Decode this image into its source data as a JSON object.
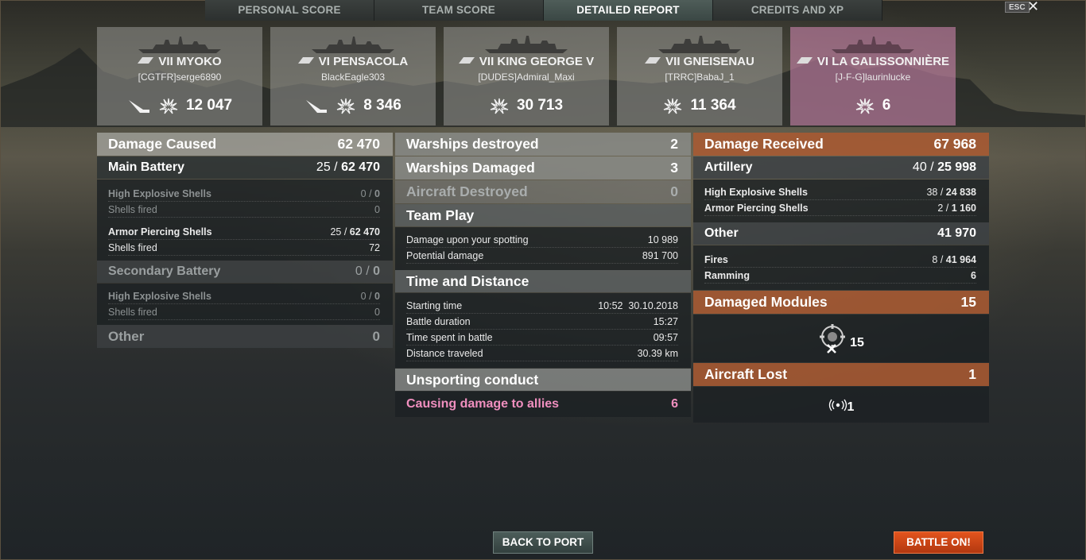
{
  "tabs": [
    {
      "label": "PERSONAL SCORE"
    },
    {
      "label": "TEAM SCORE"
    },
    {
      "label": "DETAILED REPORT"
    },
    {
      "label": "CREDITS AND XP"
    }
  ],
  "esc_label": "ESC",
  "ships": [
    {
      "name": "VII MYOKO",
      "player": "[CGTFR]serge6890",
      "damage": "12 047",
      "sunk": true
    },
    {
      "name": "VI PENSACOLA",
      "player": "BlackEagle303",
      "damage": "8 346",
      "sunk": true
    },
    {
      "name": "VII KING GEORGE V",
      "player": "[DUDES]Admiral_Maxi",
      "damage": "30 713",
      "sunk": false
    },
    {
      "name": "VII GNEISENAU",
      "player": "[TRRC]BabaJ_1",
      "damage": "11 364",
      "sunk": false
    },
    {
      "name": "VI LA GALISSONNIÈRE",
      "player": "[J-F-G]laurinlucke",
      "damage": "6",
      "sunk": false,
      "ally": true
    }
  ],
  "left": {
    "damage_caused": {
      "label": "Damage Caused",
      "value": "62 470"
    },
    "main_battery": {
      "label": "Main Battery",
      "hits": "25",
      "total": "62 470"
    },
    "mb_he": {
      "label": "High Explosive Shells",
      "hits": "0",
      "dmg": "0",
      "fired_label": "Shells fired",
      "fired": "0"
    },
    "mb_ap": {
      "label": "Armor Piercing Shells",
      "hits": "25",
      "dmg": "62 470",
      "fired_label": "Shells fired",
      "fired": "72"
    },
    "secondary": {
      "label": "Secondary Battery",
      "hits": "0",
      "total": "0"
    },
    "sec_he": {
      "label": "High Explosive Shells",
      "hits": "0",
      "dmg": "0",
      "fired_label": "Shells fired",
      "fired": "0"
    },
    "other": {
      "label": "Other",
      "value": "0"
    }
  },
  "middle": {
    "warships_destroyed": {
      "label": "Warships destroyed",
      "value": "2"
    },
    "warships_damaged": {
      "label": "Warships Damaged",
      "value": "3"
    },
    "aircraft_destroyed": {
      "label": "Aircraft Destroyed",
      "value": "0"
    },
    "team_play": {
      "label": "Team Play",
      "rows": [
        {
          "label": "Damage upon your spotting",
          "value": "10 989"
        },
        {
          "label": "Potential damage",
          "value": "891 700"
        }
      ]
    },
    "time_distance": {
      "label": "Time and Distance",
      "rows": [
        {
          "label": "Starting time",
          "value": "10:52  30.10.2018"
        },
        {
          "label": "Battle duration",
          "value": "15:27"
        },
        {
          "label": "Time spent in battle",
          "value": "09:57"
        },
        {
          "label": "Distance traveled",
          "value": "30.39 km"
        }
      ]
    },
    "unsporting": {
      "label": "Unsporting conduct",
      "row_label": "Causing damage to allies",
      "row_value": "6"
    }
  },
  "right": {
    "damage_received": {
      "label": "Damage Received",
      "value": "67 968"
    },
    "artillery": {
      "label": "Artillery",
      "hits": "40",
      "total": "25 998"
    },
    "art_rows": [
      {
        "label": "High Explosive Shells",
        "hits": "38",
        "dmg": "24 838"
      },
      {
        "label": "Armor Piercing Shells",
        "hits": "2",
        "dmg": "1 160"
      }
    ],
    "other": {
      "label": "Other",
      "value": "41 970"
    },
    "fires": {
      "label": "Fires",
      "hits": "8",
      "dmg": "41 964"
    },
    "ramming": {
      "label": "Ramming",
      "value": "6"
    },
    "modules": {
      "label": "Damaged Modules",
      "value": "15",
      "icon_count": "15"
    },
    "aircraft_lost": {
      "label": "Aircraft Lost",
      "value": "1",
      "icon_count": "1"
    }
  },
  "buttons": {
    "back": "BACK TO PORT",
    "battle": "BATTLE ON!"
  },
  "colors": {
    "accent_orange": "#d9481a",
    "ally_pink": "#f08fbf",
    "received_brown": "#a85a32"
  }
}
